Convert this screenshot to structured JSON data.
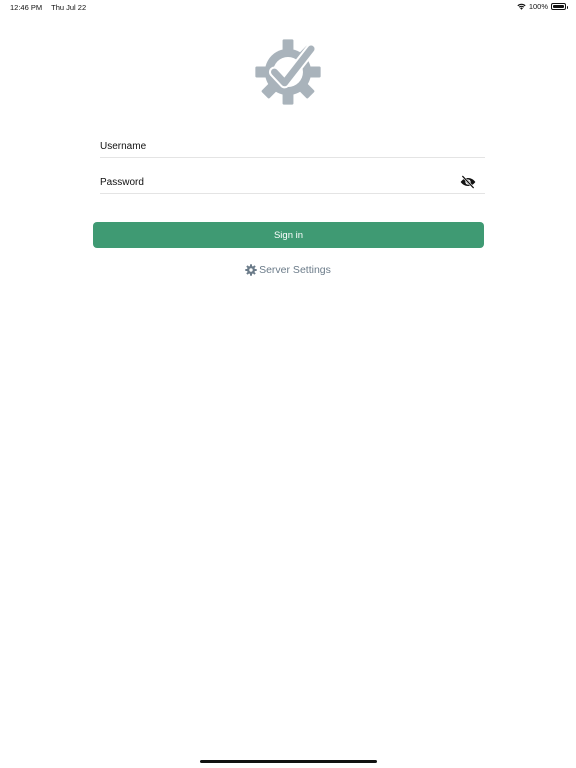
{
  "status_bar": {
    "time": "12:46 PM",
    "date": "Thu Jul 22",
    "battery_percent": "100%",
    "icons": [
      "wifi-icon",
      "battery-icon"
    ]
  },
  "logo": {
    "icon": "gear-checkmark-logo-icon",
    "color": "#a9b3bb"
  },
  "login_form": {
    "username_placeholder": "Username",
    "username_value": "",
    "password_placeholder": "Password",
    "password_value": "",
    "password_toggle_icon": "eye-slash-icon",
    "sign_in_label": "Sign in",
    "sign_in_color": "#3f9a73"
  },
  "server_settings": {
    "label": "Server Settings",
    "icon": "gear-icon",
    "color": "#6b7b89"
  }
}
